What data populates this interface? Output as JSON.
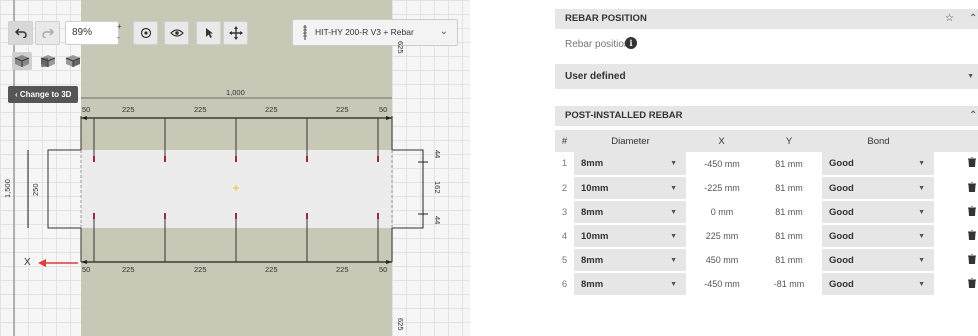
{
  "canvas": {
    "zoom": "89%",
    "product": "HIT-HY 200-R V3 + Rebar",
    "change_3d_label": "Change to 3D",
    "dims": {
      "top_total": "1,000",
      "segments_top": [
        "50",
        "225",
        "225",
        "225",
        "225",
        "50"
      ],
      "segments_bottom": [
        "50",
        "225",
        "225",
        "225",
        "225",
        "50"
      ],
      "right_top": "625",
      "right_bottom": "625",
      "left_total": "1,500",
      "left_inner": "250",
      "right_44_top": "44",
      "right_162": "162",
      "right_44_bottom": "44"
    },
    "axis_label": "X"
  },
  "panel": {
    "rebar_position": {
      "title": "REBAR POSITION",
      "field_label": "Rebar position",
      "selected": "User defined"
    },
    "post_installed": {
      "title": "POST-INSTALLED REBAR",
      "columns": [
        "#",
        "Diameter",
        "X",
        "Y",
        "Bond"
      ],
      "rows": [
        {
          "n": "1",
          "diameter": "8mm",
          "x": "-450 mm",
          "y": "81 mm",
          "bond": "Good"
        },
        {
          "n": "2",
          "diameter": "10mm",
          "x": "-225 mm",
          "y": "81 mm",
          "bond": "Good"
        },
        {
          "n": "3",
          "diameter": "8mm",
          "x": "0 mm",
          "y": "81 mm",
          "bond": "Good"
        },
        {
          "n": "4",
          "diameter": "10mm",
          "x": "225 mm",
          "y": "81 mm",
          "bond": "Good"
        },
        {
          "n": "5",
          "diameter": "8mm",
          "x": "450 mm",
          "y": "81 mm",
          "bond": "Good"
        },
        {
          "n": "6",
          "diameter": "8mm",
          "x": "-450 mm",
          "y": "-81 mm",
          "bond": "Good"
        }
      ]
    }
  },
  "colors": {
    "concrete": "#c7c8b6",
    "slot": "#e8e8e8",
    "rebar": "#9b2c3c",
    "axis": "#e03c3c"
  }
}
